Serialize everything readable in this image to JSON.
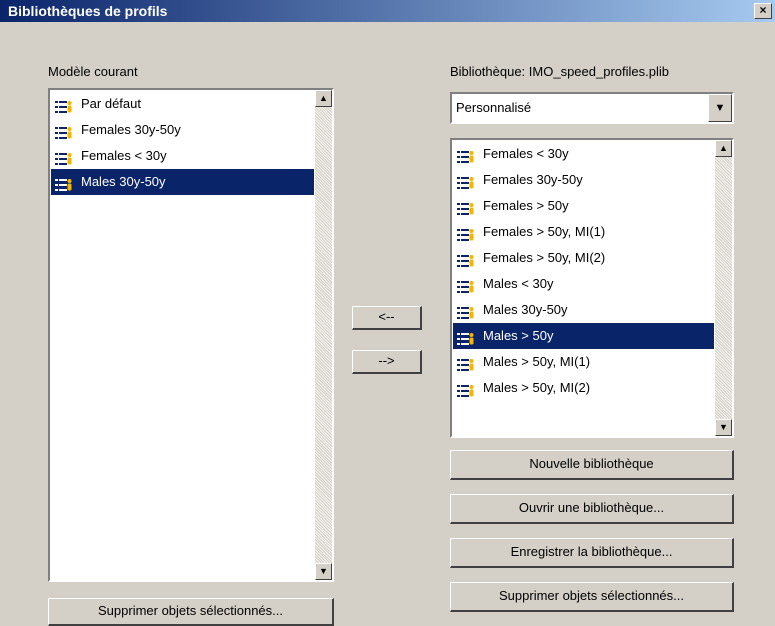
{
  "window": {
    "title": "Bibliothèques de profils",
    "close_label": "×"
  },
  "left": {
    "label": "Modèle courant",
    "items": [
      {
        "label": "Par défaut",
        "selected": false
      },
      {
        "label": "Females 30y-50y",
        "selected": false
      },
      {
        "label": "Females < 30y",
        "selected": false
      },
      {
        "label": "Males 30y-50y",
        "selected": true
      }
    ],
    "delete_button": "Supprimer objets sélectionnés..."
  },
  "middle": {
    "copy_left": "<--",
    "copy_right": "-->"
  },
  "right": {
    "library_label": "Bibliothèque: IMO_speed_profiles.plib",
    "combo_value": "Personnalisé",
    "items": [
      {
        "label": "Females < 30y",
        "selected": false
      },
      {
        "label": "Females 30y-50y",
        "selected": false
      },
      {
        "label": "Females > 50y",
        "selected": false
      },
      {
        "label": "Females > 50y, MI(1)",
        "selected": false
      },
      {
        "label": "Females > 50y, MI(2)",
        "selected": false
      },
      {
        "label": "Males < 30y",
        "selected": false
      },
      {
        "label": "Males 30y-50y",
        "selected": false
      },
      {
        "label": "Males > 50y",
        "selected": true
      },
      {
        "label": "Males > 50y, MI(1)",
        "selected": false
      },
      {
        "label": "Males > 50y, MI(2)",
        "selected": false
      }
    ],
    "new_library": "Nouvelle bibliothèque",
    "open_library": "Ouvrir une bibliothèque...",
    "save_library": "Enregistrer la bibliothèque...",
    "delete_button": "Supprimer objets sélectionnés..."
  },
  "icons": {
    "profile": "profile-list-icon",
    "scroll_up": "scroll-up-arrow-icon",
    "scroll_down": "scroll-down-arrow-icon",
    "dropdown": "dropdown-arrow-icon"
  }
}
